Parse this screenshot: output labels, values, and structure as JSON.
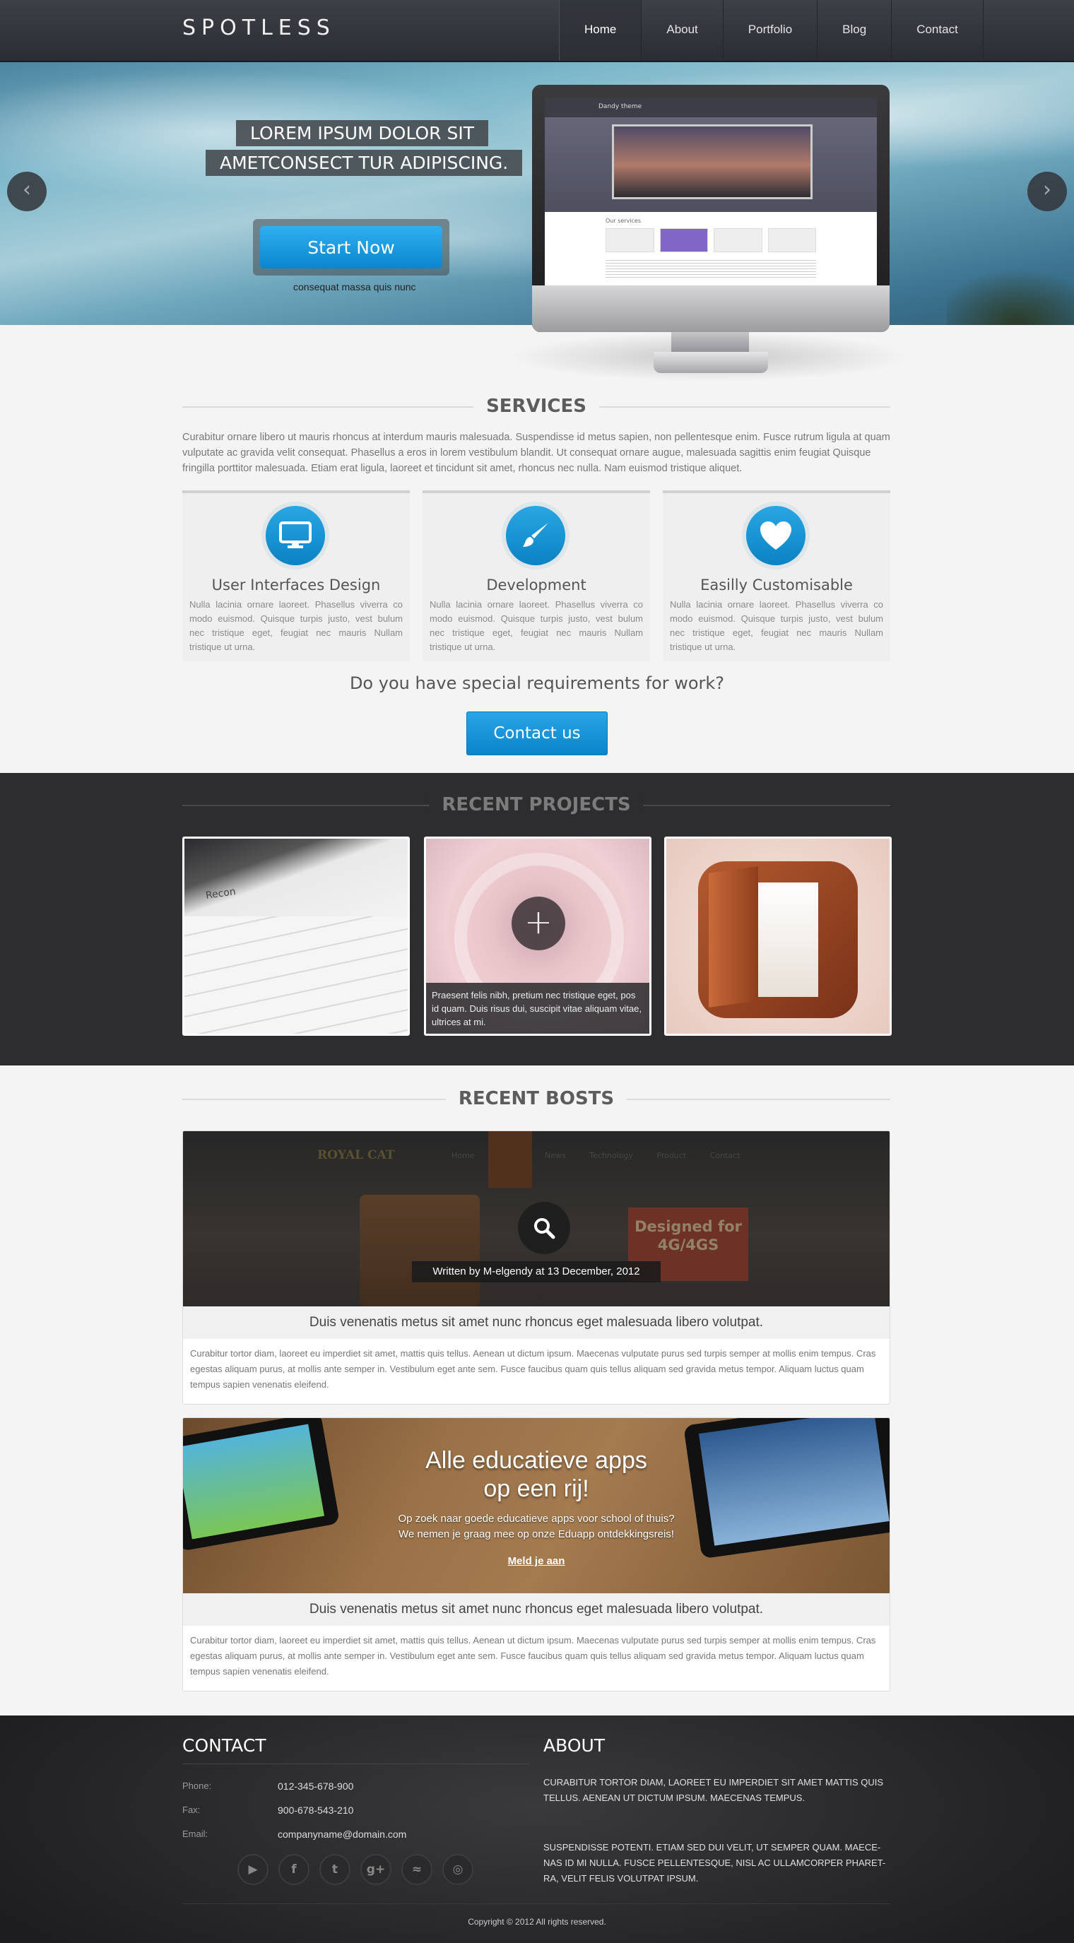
{
  "header": {
    "logo": "SPOTLESS",
    "nav": [
      "Home",
      "About",
      "Portfolio",
      "Blog",
      "Contact"
    ],
    "active_nav": "Home"
  },
  "hero": {
    "line1": "LOREM IPSUM DOLOR SIT",
    "line2": "AMETCONSECT TUR ADIPISCING.",
    "button": "Start Now",
    "subtext": "consequat massa quis nunc",
    "monitor_screen_title": "Dandy theme",
    "monitor_services_label": "Our services"
  },
  "services": {
    "heading": "SERVICES",
    "intro": "Curabitur ornare libero ut mauris rhoncus at interdum mauris malesuada. Suspendisse id metus sapien, non pellentesque enim. Fusce rutrum ligula at quam vulputate ac gravida velit consequat. Phasellus a eros in lorem vestibulum blandit. Ut consequat ornare augue, malesuada sagittis enim feugiat Quisque fringilla porttitor malesuada. Etiam erat ligula, laoreet et tincidunt sit amet, rhoncus nec nulla. Nam euismod tristique aliquet.",
    "cards": [
      {
        "title": "User Interfaces Design",
        "icon": "monitor-icon",
        "desc": "Nulla lacinia ornare laoreet. Phasellus viverra co modo euismod. Quisque turpis justo, vest bulum nec tristique eget, feugiat nec mauris Nullam tristique ut urna."
      },
      {
        "title": "Development",
        "icon": "brush-icon",
        "desc": "Nulla lacinia ornare laoreet. Phasellus viverra co modo euismod. Quisque turpis justo, vest bulum nec tristique eget, feugiat nec mauris Nullam tristique ut urna."
      },
      {
        "title": "Easilly Customisable",
        "icon": "heart-icon",
        "desc": "Nulla lacinia ornare laoreet. Phasellus viverra co modo euismod. Quisque turpis justo, vest bulum nec tristique eget, feugiat nec mauris Nullam tristique ut urna."
      }
    ],
    "special_question": "Do you have special requirements for work?",
    "contact_button": "Contact us"
  },
  "projects": {
    "heading": "RECENT PROJECTS",
    "recon_label": "Recon",
    "caption": "Praesent felis nibh, pretium nec tristique eget, pos id quam. Duis risus dui, suscipit vitae aliquam vitae, ultrices at mi."
  },
  "posts": {
    "heading": "RECENT BOSTS",
    "items": [
      {
        "written_by": "Written by M-elgendy at 13 December, 2012",
        "image_logo": "ROYAL CAT",
        "image_nav": "Home About News Technology Product Contact",
        "image_ad": "Designed for 4G/4GS",
        "title": "Duis venenatis metus sit amet nunc rhoncus eget malesuada libero volutpat.",
        "text": "Curabitur tortor diam, laoreet eu imperdiet sit amet, mattis quis tellus. Aenean ut dictum ipsum. Maecenas vulputate purus sed turpis semper at mollis enim tempus. Cras egestas aliquam purus, at mollis ante semper in. Vestibulum eget ante sem. Fusce faucibus quam quis tellus aliquam sed gravida metus tempor. Aliquam luctus quam tempus sapien venenatis eleifend."
      },
      {
        "image_heading_1": "Alle educatieve apps",
        "image_heading_2": "op een rij!",
        "image_line_1": "Op zoek naar goede educatieve apps voor school of thuis?",
        "image_line_2": "We nemen je graag mee op onze Eduapp ontdekkingsreis!",
        "image_link": "Meld je aan",
        "title": "Duis venenatis metus sit amet nunc rhoncus eget malesuada libero volutpat.",
        "text": "Curabitur tortor diam, laoreet eu imperdiet sit amet, mattis quis tellus. Aenean ut dictum ipsum. Maecenas vulputate purus sed turpis semper at mollis enim tempus. Cras egestas aliquam purus, at mollis ante semper in. Vestibulum eget ante sem. Fusce faucibus quam quis tellus aliquam sed gravida metus tempor. Aliquam luctus quam tempus sapien venenatis eleifend."
      }
    ]
  },
  "footer": {
    "contact_heading": "CONTACT",
    "about_heading": "ABOUT",
    "phone_label": "Phone:",
    "phone": "012-345-678-900",
    "fax_label": "Fax:",
    "fax": "900-678-543-210",
    "email_label": "Email:",
    "email": "companyname@domain.com",
    "about_p1": "Curabitur tortor diam, laoreet eu imperdiet sit amet mattis quis tellus. Aenean ut dictum ipsum. Maecenas tempus.",
    "about_p2": "Suspendisse potenti. Etiam sed dui velit, ut semper quam. Maece-nas id mi nulla. Fusce pellentesque, nisl ac ullamcorper pharet-ra, velit felis volutpat ipsum.",
    "social": [
      "youtube-icon",
      "facebook-icon",
      "twitter-icon",
      "google-plus-icon",
      "rss-icon",
      "dribbble-icon"
    ],
    "copyright": "Copyright © 2012 All rights reserved."
  }
}
